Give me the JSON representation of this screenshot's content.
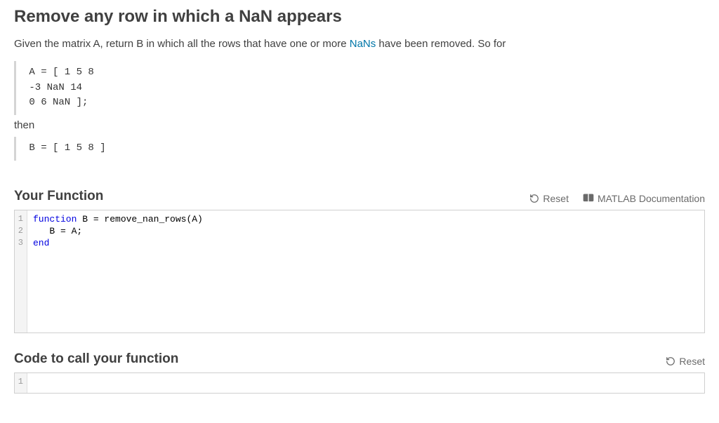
{
  "title": "Remove any row in which a NaN appears",
  "desc_before_link": "Given the matrix A, return B in which all the rows that have one or more ",
  "desc_link_text": "NaNs",
  "desc_after_link": " have been removed. So for",
  "example_A": " A = [ 1 5 8\n -3 NaN 14\n 0 6 NaN ];",
  "then_text": "then",
  "example_B": " B = [ 1 5 8 ]",
  "your_function": {
    "heading": "Your Function",
    "reset_label": "Reset",
    "doc_label": "MATLAB Documentation",
    "code_lines": [
      {
        "n": 1,
        "tokens": [
          {
            "t": "function",
            "c": "kw"
          },
          {
            "t": " B = remove_nan_rows(A)",
            "c": ""
          }
        ]
      },
      {
        "n": 2,
        "tokens": [
          {
            "t": "   B = A;",
            "c": ""
          }
        ]
      },
      {
        "n": 3,
        "tokens": [
          {
            "t": "end",
            "c": "kw"
          }
        ]
      }
    ]
  },
  "call_section": {
    "heading": "Code to call your function",
    "reset_label": "Reset",
    "code_lines": [
      {
        "n": 1,
        "tokens": []
      }
    ]
  }
}
